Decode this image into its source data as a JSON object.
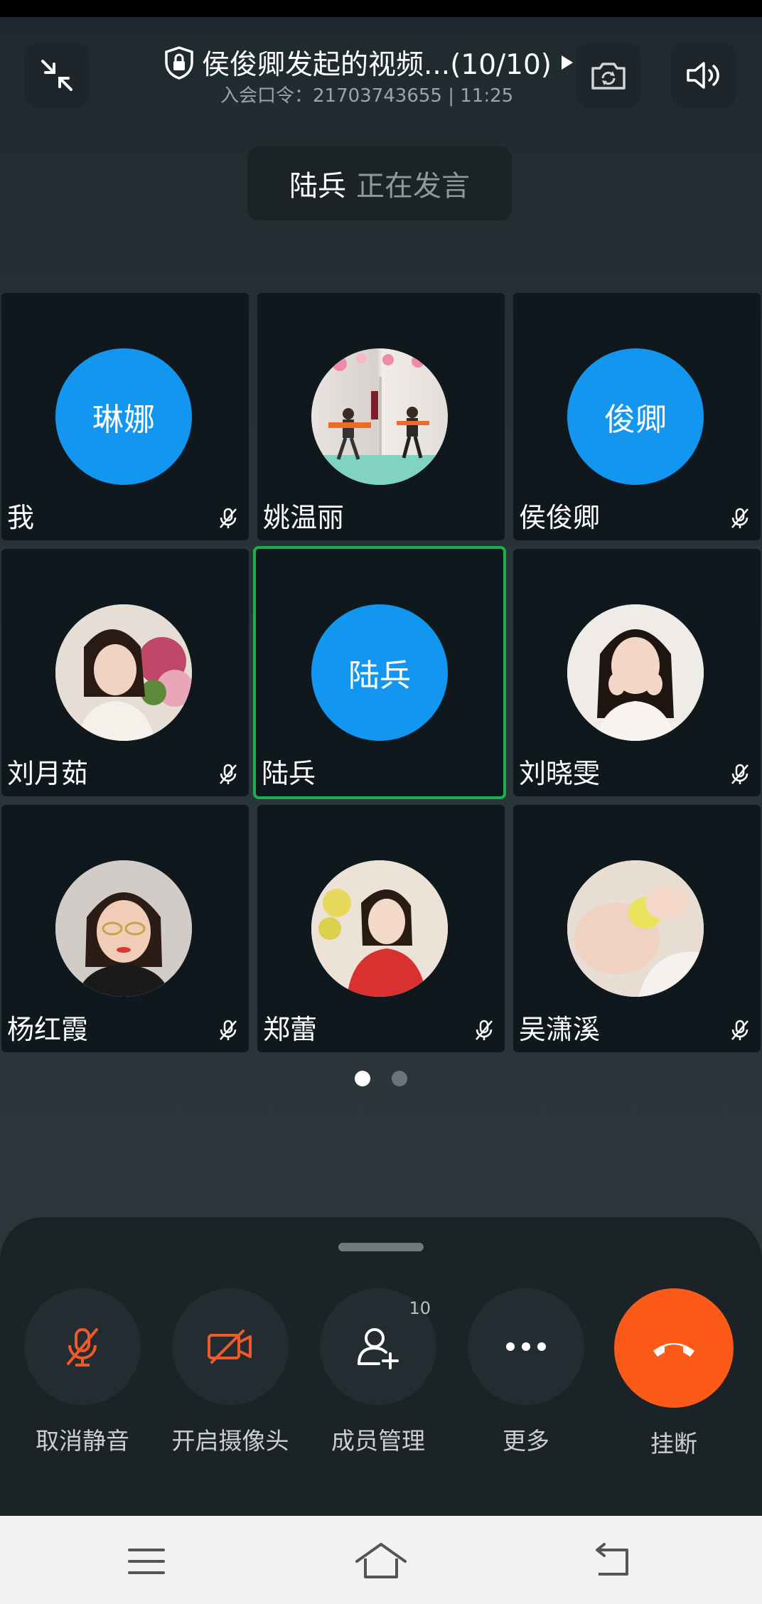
{
  "header": {
    "title": "侯俊卿发起的视频...(10/10)",
    "subtitle": "入会口令：21703743655 | 11:25",
    "speaker_name": "陆兵",
    "speaker_status": "正在发言"
  },
  "participants": [
    {
      "name": "我",
      "avatar_text": "琳娜",
      "avatar_type": "text",
      "muted": true
    },
    {
      "name": "姚温丽",
      "avatar_text": "",
      "avatar_type": "photo",
      "muted": false
    },
    {
      "name": "侯俊卿",
      "avatar_text": "俊卿",
      "avatar_type": "text",
      "muted": true
    },
    {
      "name": "刘月茹",
      "avatar_text": "",
      "avatar_type": "photo",
      "muted": true
    },
    {
      "name": "陆兵",
      "avatar_text": "陆兵",
      "avatar_type": "text",
      "muted": false,
      "active": true
    },
    {
      "name": "刘晓雯",
      "avatar_text": "",
      "avatar_type": "photo",
      "muted": true
    },
    {
      "name": "杨红霞",
      "avatar_text": "",
      "avatar_type": "photo",
      "muted": true
    },
    {
      "name": "郑蕾",
      "avatar_text": "",
      "avatar_type": "photo",
      "muted": true
    },
    {
      "name": "吴潇溪",
      "avatar_text": "",
      "avatar_type": "photo",
      "muted": true
    }
  ],
  "pager": {
    "current": 1,
    "total": 2
  },
  "controls": {
    "unmute_label": "取消静音",
    "camera_label": "开启摄像头",
    "members_label": "成员管理",
    "members_count": "10",
    "more_label": "更多",
    "hangup_label": "挂断"
  },
  "colors": {
    "accent_blue": "#1296f0",
    "speaking_green": "#18b04a",
    "hangup_orange": "#fb5a18",
    "off_icon_orange": "#f05a28"
  }
}
